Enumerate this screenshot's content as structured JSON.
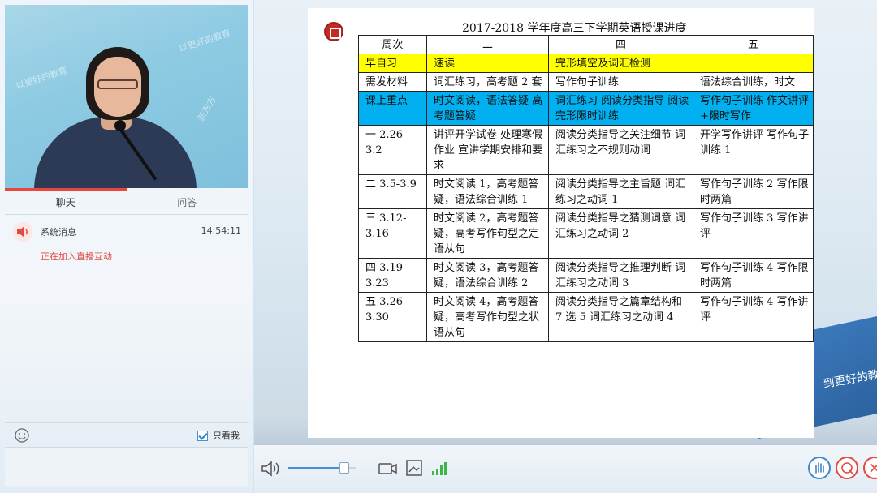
{
  "video": {
    "watermark_1": "以更好的教育",
    "watermark_2": "以更好的教育",
    "watermark_3": "新东方"
  },
  "tabs": [
    {
      "label": "聊天"
    },
    {
      "label": "问答"
    }
  ],
  "chat": {
    "message": {
      "sender": "系统消息",
      "time": "14:54:11",
      "text": "正在加入直播互动"
    }
  },
  "input_toolbar": {
    "only_teacher_label": "只看我",
    "only_teacher_checked": true
  },
  "slide": {
    "doc_title": "2017-2018 学年度高三下学期英语授课进度",
    "background_text": "到更好的教育",
    "table": {
      "headers": [
        "周次",
        "二",
        "四",
        "五"
      ],
      "rows": [
        {
          "style": "yellow",
          "cells": [
            "早自习",
            "速读",
            "完形填空及词汇检测",
            ""
          ]
        },
        {
          "style": "plain",
          "cells": [
            "需发材料",
            "词汇练习，高考题 2 套",
            "写作句子训练",
            "语法综合训练，时文"
          ]
        },
        {
          "style": "blue",
          "cells": [
            "课上重点",
            "时文阅读，语法答疑 高考题答疑",
            "词汇练习 阅读分类指导 阅读完形限时训练",
            "写作句子训练 作文讲评+限时写作"
          ]
        },
        {
          "style": "plain",
          "cells": [
            "一 2.26-3.2",
            "讲评开学试卷 处理寒假作业 宣讲学期安排和要求",
            "阅读分类指导之关注细节 词汇练习之不规则动词",
            "开学写作讲评 写作句子训练 1"
          ]
        },
        {
          "style": "plain",
          "cells": [
            "二 3.5-3.9",
            "时文阅读 1，高考题答疑，语法综合训练 1",
            "阅读分类指导之主旨题 词汇练习之动词 1",
            "写作句子训练 2 写作限时两篇"
          ]
        },
        {
          "style": "plain",
          "cells": [
            "三 3.12-3.16",
            "时文阅读 2，高考题答疑，高考写作句型之定语从句",
            "阅读分类指导之猜测词意 词汇练习之动词 2",
            "写作句子训练 3 写作讲评"
          ]
        },
        {
          "style": "plain",
          "cells": [
            "四 3.19-3.23",
            "时文阅读 3，高考题答疑，语法综合训练 2",
            "阅读分类指导之推理判断 词汇练习之动词 3",
            "写作句子训练 4 写作限时两篇"
          ]
        },
        {
          "style": "plain",
          "cells": [
            "五 3.26-3.30",
            "时文阅读 4，高考题答疑，高考写作句型之状语从句",
            "阅读分类指导之篇章结构和 7 选 5 词汇练习之动词 4",
            "写作句子训练 4 写作讲评"
          ]
        }
      ]
    }
  },
  "bottom_bar": {
    "volume_level": 0.82
  },
  "colors": {
    "accent": "#3f86cc",
    "alert": "#e04a3f",
    "row_yellow": "#ffff00",
    "row_blue": "#00b0f0"
  }
}
